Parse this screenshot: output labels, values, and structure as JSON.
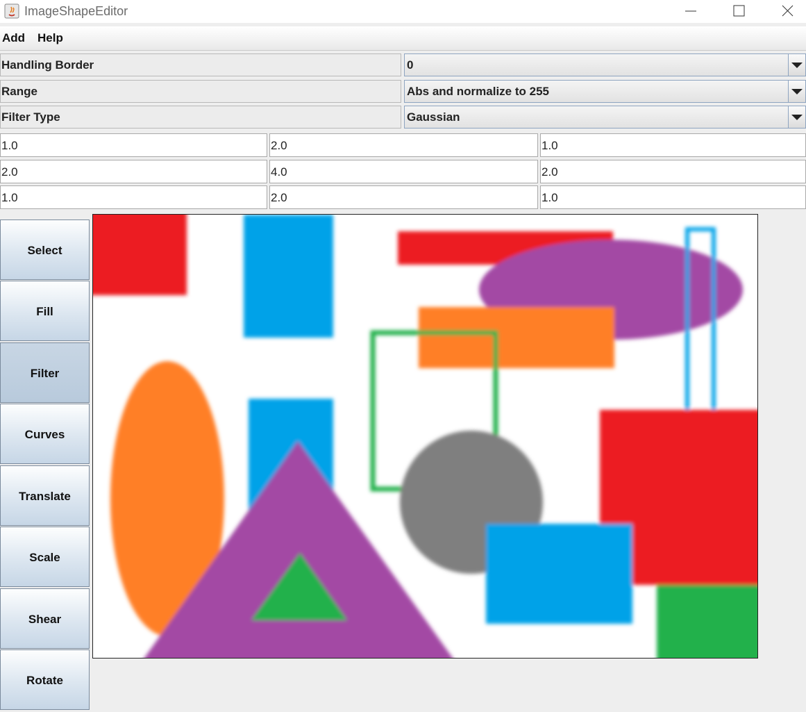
{
  "window": {
    "title": "ImageShapeEditor"
  },
  "menu": {
    "items": [
      "Add",
      "Help"
    ]
  },
  "properties": [
    {
      "label": "Handling Border",
      "value": "0"
    },
    {
      "label": "Range",
      "value": "Abs and normalize to 255"
    },
    {
      "label": "Filter Type",
      "value": "Gaussian"
    }
  ],
  "kernel": [
    [
      "1.0",
      "2.0",
      "1.0"
    ],
    [
      "2.0",
      "4.0",
      "2.0"
    ],
    [
      "1.0",
      "2.0",
      "1.0"
    ]
  ],
  "tools": {
    "select": "Select",
    "fill": "Fill",
    "filter": "Filter",
    "curves": "Curves",
    "translate": "Translate",
    "scale": "Scale",
    "shear": "Shear",
    "rotate": "Rotate",
    "active": "filter"
  },
  "colors": {
    "red": "#ec1c24",
    "blue": "#00a2e8",
    "purple": "#a349a4",
    "orange": "#ff7f27",
    "green": "#22b14c",
    "gray": "#7f7f7f"
  }
}
